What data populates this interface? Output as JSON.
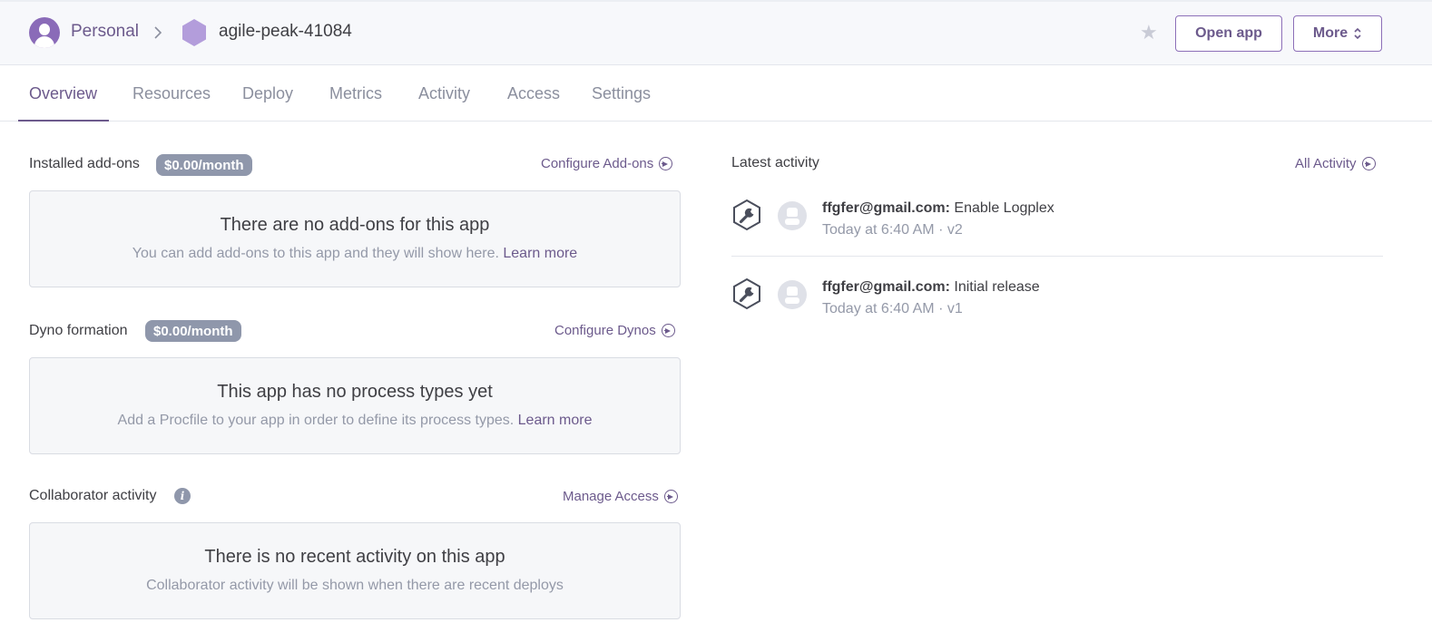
{
  "header": {
    "breadcrumb_personal": "Personal",
    "app_name": "agile-peak-41084",
    "open_app_label": "Open app",
    "more_label": "More",
    "brand_color": "#6c5a8c"
  },
  "tabs": [
    {
      "label": "Overview",
      "active": true
    },
    {
      "label": "Resources"
    },
    {
      "label": "Deploy"
    },
    {
      "label": "Metrics"
    },
    {
      "label": "Activity"
    },
    {
      "label": "Access"
    },
    {
      "label": "Settings"
    }
  ],
  "addons": {
    "title": "Installed add-ons",
    "price": "$0.00/month",
    "link": "Configure Add-ons",
    "empty_title": "There are no add-ons for this app",
    "empty_sub": "You can add add-ons to this app and they will show here.",
    "learn_more": "Learn more"
  },
  "dynos": {
    "title": "Dyno formation",
    "price": "$0.00/month",
    "link": "Configure Dynos",
    "empty_title": "This app has no process types yet",
    "empty_sub": "Add a Procfile to your app in order to define its process types.",
    "learn_more": "Learn more"
  },
  "collaborators": {
    "title": "Collaborator activity",
    "info_icon": "i",
    "link": "Manage Access",
    "empty_title": "There is no recent activity on this app",
    "empty_sub": "Collaborator activity will be shown when there are recent deploys"
  },
  "activity": {
    "title": "Latest activity",
    "link": "All Activity",
    "items": [
      {
        "user": "ffgfer@gmail.com:",
        "action": "Enable Logplex",
        "meta": "Today at 6:40 AM · v2"
      },
      {
        "user": "ffgfer@gmail.com:",
        "action": "Initial release",
        "meta": "Today at 6:40 AM · v1"
      }
    ]
  }
}
